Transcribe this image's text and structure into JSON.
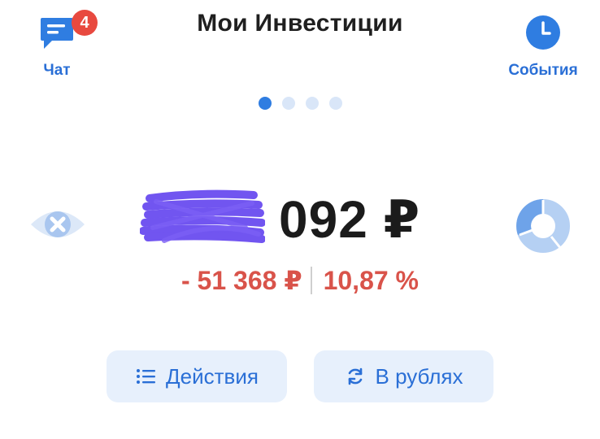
{
  "header": {
    "title": "Мои Инвестиции",
    "chat": {
      "label": "Чат",
      "badge": "4",
      "icon": "chat-icon"
    },
    "events": {
      "label": "События",
      "icon": "clock-icon"
    }
  },
  "pager": {
    "count": 4,
    "active_index": 0
  },
  "portfolio": {
    "balance_visible": "092 ₽",
    "balance_masked": true,
    "change_amount": "- 51 368 ₽",
    "change_percent": "10,87 %",
    "hide_toggle_icon": "eye-off-icon",
    "allocation_icon": "donut-chart-icon"
  },
  "actions": {
    "actions_label": "Действия",
    "currency_label": "В рублях"
  },
  "colors": {
    "accent": "#2a6fd6",
    "negative": "#d9534a",
    "badge": "#e8493f",
    "mask": "#6a4cf0"
  }
}
